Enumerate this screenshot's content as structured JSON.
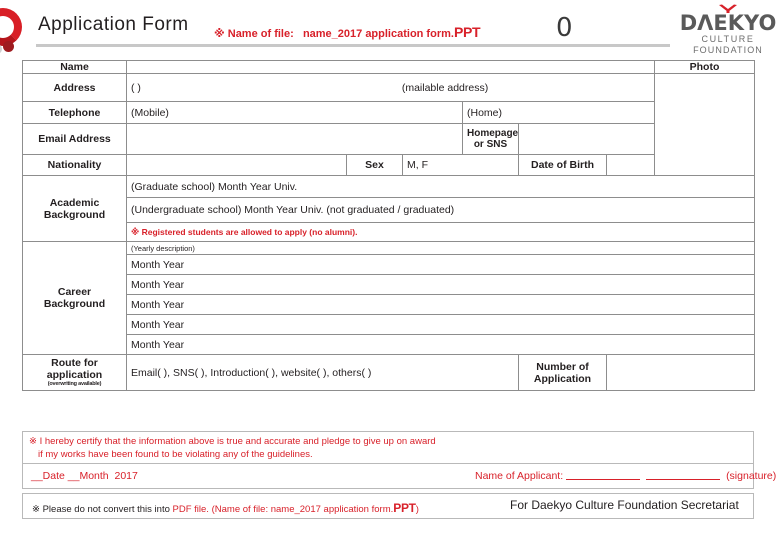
{
  "header": {
    "title": "Application Form",
    "file_note_prefix": "※ Name of file:",
    "file_name": "name_2017 application form.",
    "file_ext": "PPT",
    "zero_mark": "0",
    "logo": {
      "word": "DΛEKYO",
      "line1": "CULTURE",
      "line2": "FOUNDATION"
    }
  },
  "table": {
    "labels": {
      "name": "Name",
      "address": "Address",
      "telephone": "Telephone",
      "email": "Email Address",
      "nationality": "Nationality",
      "sex": "Sex",
      "date_of_birth": "Date of Birth",
      "homepage_or_sns": "Homepage\nor SNS",
      "homepage_line1": "Homepage",
      "homepage_line2": "or SNS",
      "photo": "Photo",
      "academic_line1": "Academic",
      "academic_line2": "Background",
      "career_line1": "Career",
      "career_line2": "Background",
      "route_line1": "Route for",
      "route_line2": "application",
      "route_sub": "(overwriting available)",
      "number_line1": "Number of",
      "number_line2": "Application"
    },
    "values": {
      "address_parens": "(                    )",
      "mailable_address": "(mailable address)",
      "mobile": "(Mobile)",
      "home": "(Home)",
      "sex_options": "M, F",
      "graduate_row": "(Graduate school)   Month   Year                Univ.",
      "undergraduate_row": "(Undergraduate school)    Month   Year                Univ.   (not graduated / graduated)",
      "academic_notice": "※ Registered students are allowed to apply (no alumni).",
      "career_header": "(Yearly description)",
      "career_rows": [
        "Month   Year",
        "Month   Year",
        "Month   Year",
        "Month   Year",
        "Month   Year"
      ],
      "route_value": "Email(     ),  SNS(     ),  Introduction(     ),  website(     ),  others(                    )"
    }
  },
  "certification": {
    "line1": "※ I hereby certify that the information above is true and accurate and pledge to give up on award",
    "line2": "if my works have been found to be violating any of the guidelines."
  },
  "signature_row": {
    "date_label": "__Date __Month",
    "year": "2017",
    "applicant_label": "Name of Applicant:",
    "signature_label": "(signature)"
  },
  "footer": {
    "prefix": "※ Please do not convert this into",
    "pdf": "PDF file.",
    "filename_note": "(Name of file: name_2017 application form.",
    "ppt": "PPT",
    "closing_paren": ")",
    "secretariat": "For Daekyo Culture Foundation Secretariat"
  }
}
